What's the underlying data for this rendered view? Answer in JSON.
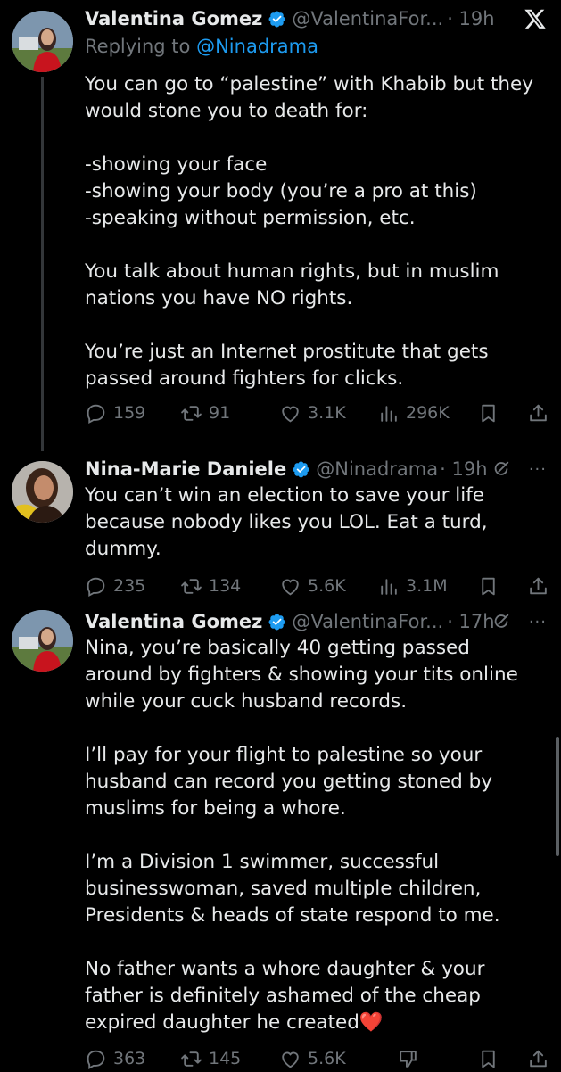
{
  "tweets": [
    {
      "name": "Valentina Gomez",
      "handle": "@ValentinaFor...",
      "time": "· 19h",
      "replying_label": "Replying to",
      "replying_handle": "@Ninadrama",
      "text": "You can go to “palestine” with Khabib but they would stone you to death for:\n\n-showing your face\n-showing your body (you’re a pro at this)\n-speaking without permission, etc.\n\nYou talk about human rights, but in muslim nations you have NO rights.\n\nYou’re just an Internet prostitute that gets passed around fighters for clicks.",
      "replies": "159",
      "reposts": "91",
      "likes": "3.1K",
      "views": "296K"
    },
    {
      "name": "Nina-Marie Daniele",
      "handle": "@Ninadrama",
      "time": "· 19h",
      "text": "You can’t win an election to save your life because nobody likes you LOL. Eat a turd, dummy.",
      "replies": "235",
      "reposts": "134",
      "likes": "5.6K",
      "views": "3.1M"
    },
    {
      "name": "Valentina Gomez",
      "handle": "@ValentinaFor...",
      "time": "· 17h",
      "text": "Nina, you’re basically 40 getting passed around by fighters & showing your tits online while your cuck husband records.\n\nI’ll pay for your flight to palestine so your husband can record you getting stoned by muslims for being a whore.\n\nI’m a Division 1 swimmer, successful businesswoman, saved multiple children, Presidents & heads of state respond to me.\n\nNo father wants a whore daughter & your father is definitely ashamed of the cheap expired daughter he created❤️",
      "replies": "363",
      "reposts": "145",
      "likes": "5.6K"
    }
  ],
  "colors": {
    "background": "#000000",
    "text": "#e7e9ea",
    "muted": "#71767b",
    "link": "#1d9bf0",
    "verified": "#1d9bf0"
  }
}
